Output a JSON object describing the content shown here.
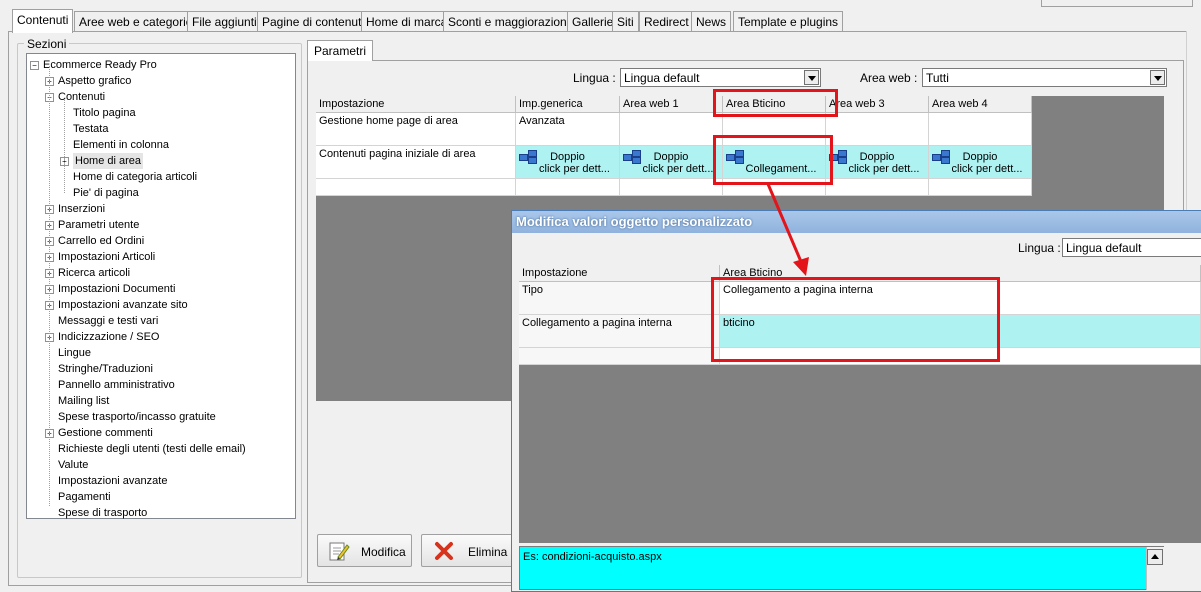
{
  "tabs": [
    "Contenuti",
    "Aree web e categorie",
    "File aggiuntivi",
    "Pagine di contenuti",
    "Home di marca",
    "Sconti e maggiorazioni",
    "Gallerie",
    "Siti",
    "Redirect",
    "News",
    "Template e plugins"
  ],
  "sections": {
    "label": "Sezioni",
    "tree": [
      {
        "label": "Ecommerce Ready Pro",
        "level": 0,
        "toggle": "−"
      },
      {
        "label": "Aspetto grafico",
        "level": 1,
        "toggle": "+"
      },
      {
        "label": "Contenuti",
        "level": 1,
        "toggle": "−"
      },
      {
        "label": "Titolo pagina",
        "level": 2,
        "toggle": ""
      },
      {
        "label": "Testata",
        "level": 2,
        "toggle": ""
      },
      {
        "label": "Elementi in colonna",
        "level": 2,
        "toggle": ""
      },
      {
        "label": "Home di area",
        "level": 2,
        "toggle": "+",
        "selected": true
      },
      {
        "label": "Home di categoria articoli",
        "level": 2,
        "toggle": ""
      },
      {
        "label": "Pie' di pagina",
        "level": 2,
        "toggle": ""
      },
      {
        "label": "Inserzioni",
        "level": 1,
        "toggle": "+"
      },
      {
        "label": "Parametri utente",
        "level": 1,
        "toggle": "+"
      },
      {
        "label": "Carrello ed Ordini",
        "level": 1,
        "toggle": "+"
      },
      {
        "label": "Impostazioni Articoli",
        "level": 1,
        "toggle": "+"
      },
      {
        "label": "Ricerca articoli",
        "level": 1,
        "toggle": "+"
      },
      {
        "label": "Impostazioni Documenti",
        "level": 1,
        "toggle": "+"
      },
      {
        "label": "Impostazioni avanzate sito",
        "level": 1,
        "toggle": "+"
      },
      {
        "label": "Messaggi e testi vari",
        "level": 1,
        "toggle": ""
      },
      {
        "label": "Indicizzazione / SEO",
        "level": 1,
        "toggle": "+"
      },
      {
        "label": "Lingue",
        "level": 1,
        "toggle": ""
      },
      {
        "label": "Stringhe/Traduzioni",
        "level": 1,
        "toggle": ""
      },
      {
        "label": "Pannello amministrativo",
        "level": 1,
        "toggle": ""
      },
      {
        "label": "Mailing list",
        "level": 1,
        "toggle": ""
      },
      {
        "label": "Spese trasporto/incasso gratuite",
        "level": 1,
        "toggle": ""
      },
      {
        "label": "Gestione commenti",
        "level": 1,
        "toggle": "+"
      },
      {
        "label": "Richieste degli utenti (testi delle email)",
        "level": 1,
        "toggle": ""
      },
      {
        "label": "Valute",
        "level": 1,
        "toggle": ""
      },
      {
        "label": "Impostazioni avanzate",
        "level": 1,
        "toggle": ""
      },
      {
        "label": "Pagamenti",
        "level": 1,
        "toggle": ""
      },
      {
        "label": "Spese di trasporto",
        "level": 1,
        "toggle": ""
      }
    ]
  },
  "parametri": {
    "tab_label": "Parametri",
    "lingua_label": "Lingua :",
    "lingua_value": "Lingua default",
    "area_label": "Area web :",
    "area_value": "Tutti",
    "headers": [
      "Impostazione",
      "Imp.generica",
      "Area web 1",
      "Area Bticino",
      "Area web 3",
      "Area web 4"
    ],
    "row1": {
      "label": "Gestione home page di area",
      "value": "Avanzata"
    },
    "row2": {
      "label": "Contenuti pagina iniziale di area",
      "cells": [
        {
          "line1": "Doppio",
          "line2": "click per dett..."
        },
        {
          "line1": "Doppio",
          "line2": "click per dett..."
        },
        {
          "line1": "",
          "line2": "Collegament..."
        },
        {
          "line1": "Doppio",
          "line2": "click per dett..."
        },
        {
          "line1": "Doppio",
          "line2": "click per dett..."
        }
      ]
    }
  },
  "buttons": {
    "modifica": "Modifica",
    "elimina": "Elimina"
  },
  "dialog": {
    "title": "Modifica valori oggetto personalizzato",
    "lingua_label": "Lingua :",
    "lingua_value": "Lingua default",
    "headers": [
      "Impostazione",
      "Area Bticino"
    ],
    "rows": [
      {
        "label": "Tipo",
        "value": "Collegamento a pagina interna"
      },
      {
        "label": "Collegamento a pagina interna",
        "value": "bticino"
      }
    ],
    "note": "Es: condizioni-acquisto.aspx"
  },
  "colors": {
    "highlight": "#e3141a",
    "cyan_cell": "#aef2f2",
    "note_bg": "#00ffff",
    "grid_bg": "#808080"
  }
}
